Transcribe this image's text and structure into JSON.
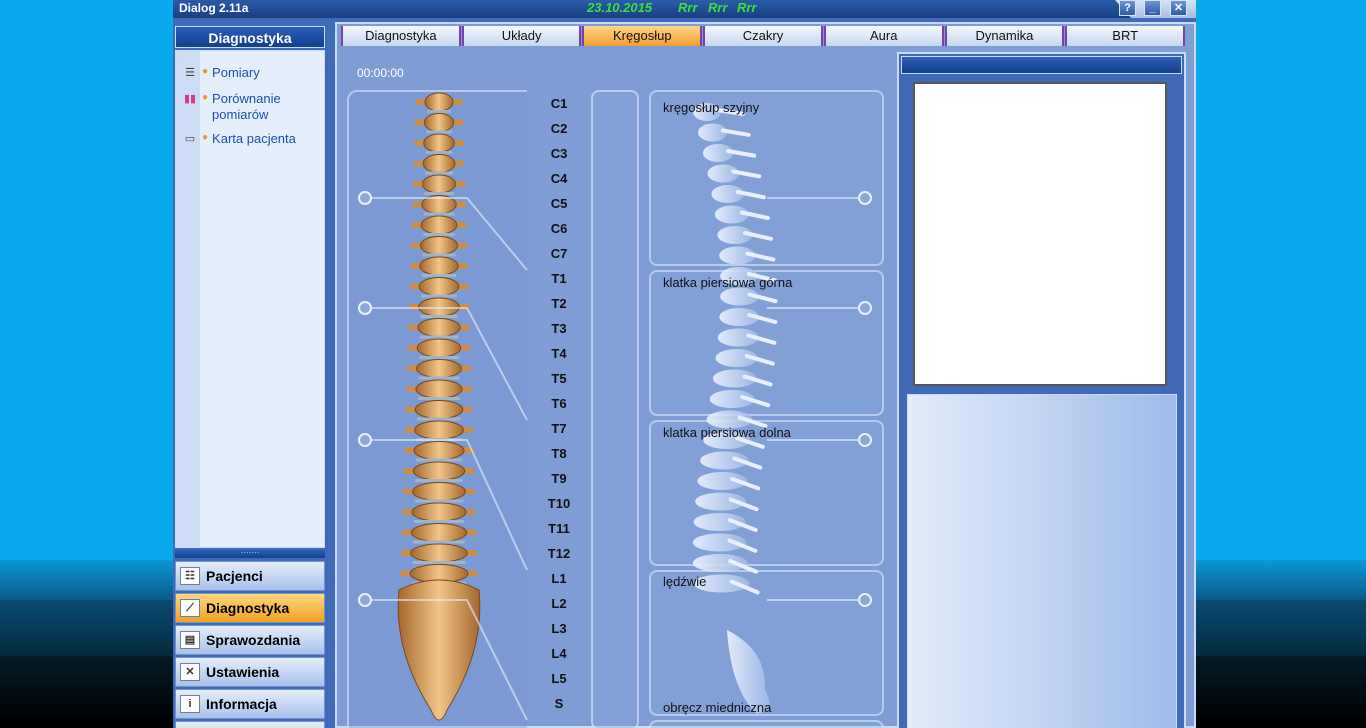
{
  "window": {
    "title": "Dialog 2.11a",
    "date": "23.10.2015",
    "status_marks": [
      "Rrr",
      "Rrr",
      "Rrr"
    ],
    "buttons": {
      "help": "?",
      "minimize": "_",
      "close": "✕"
    }
  },
  "sidebar": {
    "header": "Diagnostyka",
    "items": [
      {
        "label": "Pomiary",
        "icon": "list-icon"
      },
      {
        "label": "Porównanie pomiarów",
        "icon": "compare-icon"
      },
      {
        "label": "Karta pacjenta",
        "icon": "book-icon"
      }
    ],
    "splitter": "·······",
    "nav": [
      {
        "label": "Pacjenci",
        "icon": "patients-icon",
        "active": false
      },
      {
        "label": "Diagnostyka",
        "icon": "diagnostics-icon",
        "active": true
      },
      {
        "label": "Sprawozdania",
        "icon": "printer-icon",
        "active": false
      },
      {
        "label": "Ustawienia",
        "icon": "tools-icon",
        "active": false
      },
      {
        "label": "Informacja",
        "icon": "info-icon",
        "active": false
      }
    ]
  },
  "tabs": [
    {
      "label": "Diagnostyka",
      "active": false
    },
    {
      "label": "Układy",
      "active": false
    },
    {
      "label": "Kręgosłup",
      "active": true
    },
    {
      "label": "Czakry",
      "active": false
    },
    {
      "label": "Aura",
      "active": false
    },
    {
      "label": "Dynamika",
      "active": false
    },
    {
      "label": "BRT",
      "active": false
    }
  ],
  "timer": "00:00:00",
  "vertebrae": [
    "C1",
    "C2",
    "C3",
    "C4",
    "C5",
    "C6",
    "C7",
    "T1",
    "T2",
    "T3",
    "T4",
    "T5",
    "T6",
    "T7",
    "T8",
    "T9",
    "T10",
    "T11",
    "T12",
    "L1",
    "L2",
    "L3",
    "L4",
    "L5",
    "S"
  ],
  "segments": [
    {
      "label": "kręgosłup szyjny"
    },
    {
      "label": "klatka piersiowa górna"
    },
    {
      "label": "klatka piersiowa dolna"
    },
    {
      "label": "lędźwie"
    },
    {
      "label": "obręcz miedniczna"
    }
  ],
  "colors": {
    "accent_active": "#f2a020",
    "title_green": "#3dde3d",
    "bone": "#d9a060",
    "xray": "#dbe8fb"
  }
}
